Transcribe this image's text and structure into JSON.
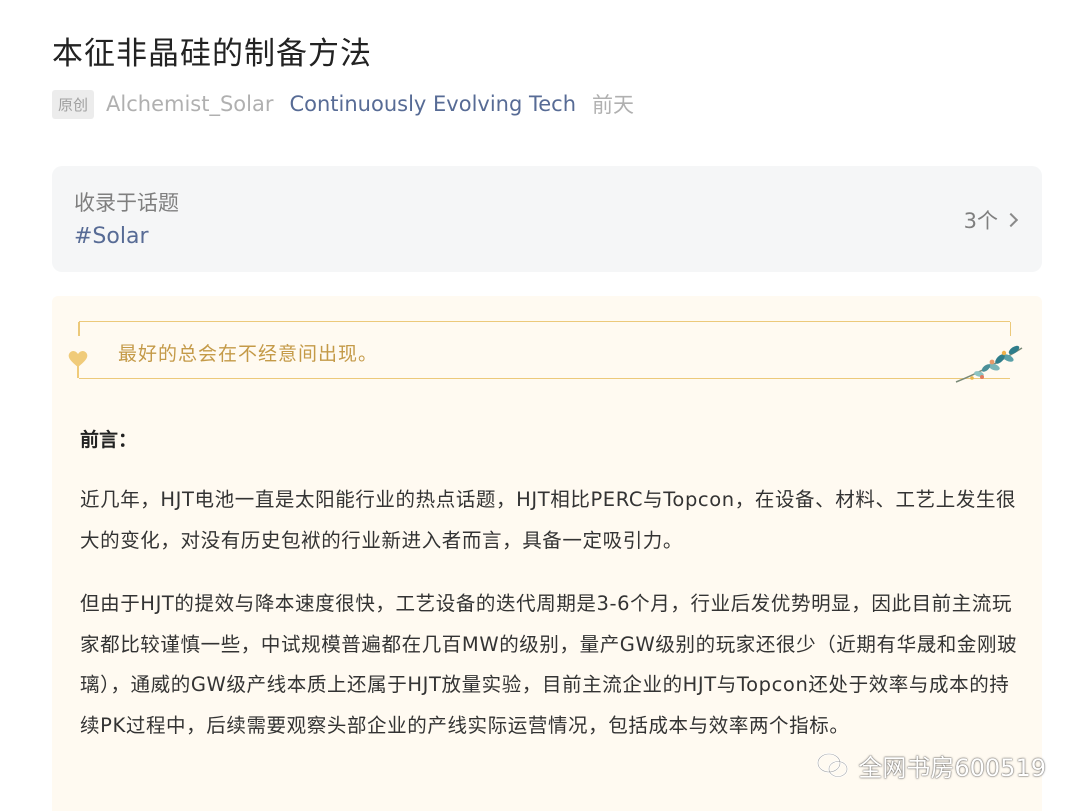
{
  "article": {
    "title": "本征非晶硅的制备方法",
    "meta": {
      "original_tag": "原创",
      "author": "Alchemist_Solar",
      "account": "Continuously Evolving Tech",
      "time": "前天"
    }
  },
  "topic": {
    "label": "收录于话题",
    "tag": "#Solar",
    "count": "3个"
  },
  "quote": {
    "text": "最好的总会在不经意间出现。"
  },
  "body": {
    "heading": "前言：",
    "paragraphs": [
      "近几年，HJT电池一直是太阳能行业的热点话题，HJT相比PERC与Topcon，在设备、材料、工艺上发生很大的变化，对没有历史包袱的行业新进入者而言，具备一定吸引力。",
      "但由于HJT的提效与降本速度很快，工艺设备的迭代周期是3-6个月，行业后发优势明显，因此目前主流玩家都比较谨慎一些，中试规模普遍都在几百MW的级别，量产GW级别的玩家还很少（近期有华晟和金刚玻璃），通威的GW级产线本质上还属于HJT放量实验，目前主流企业的HJT与Topcon还处于效率与成本的持续PK过程中，后续需要观察头部企业的产线实际运营情况，包括成本与效率两个指标。"
    ]
  },
  "watermark": {
    "text": "全网书房600519"
  },
  "colors": {
    "link": "#576b95",
    "quote_gold": "#c49a48",
    "article_bg": "#fffaf1"
  }
}
